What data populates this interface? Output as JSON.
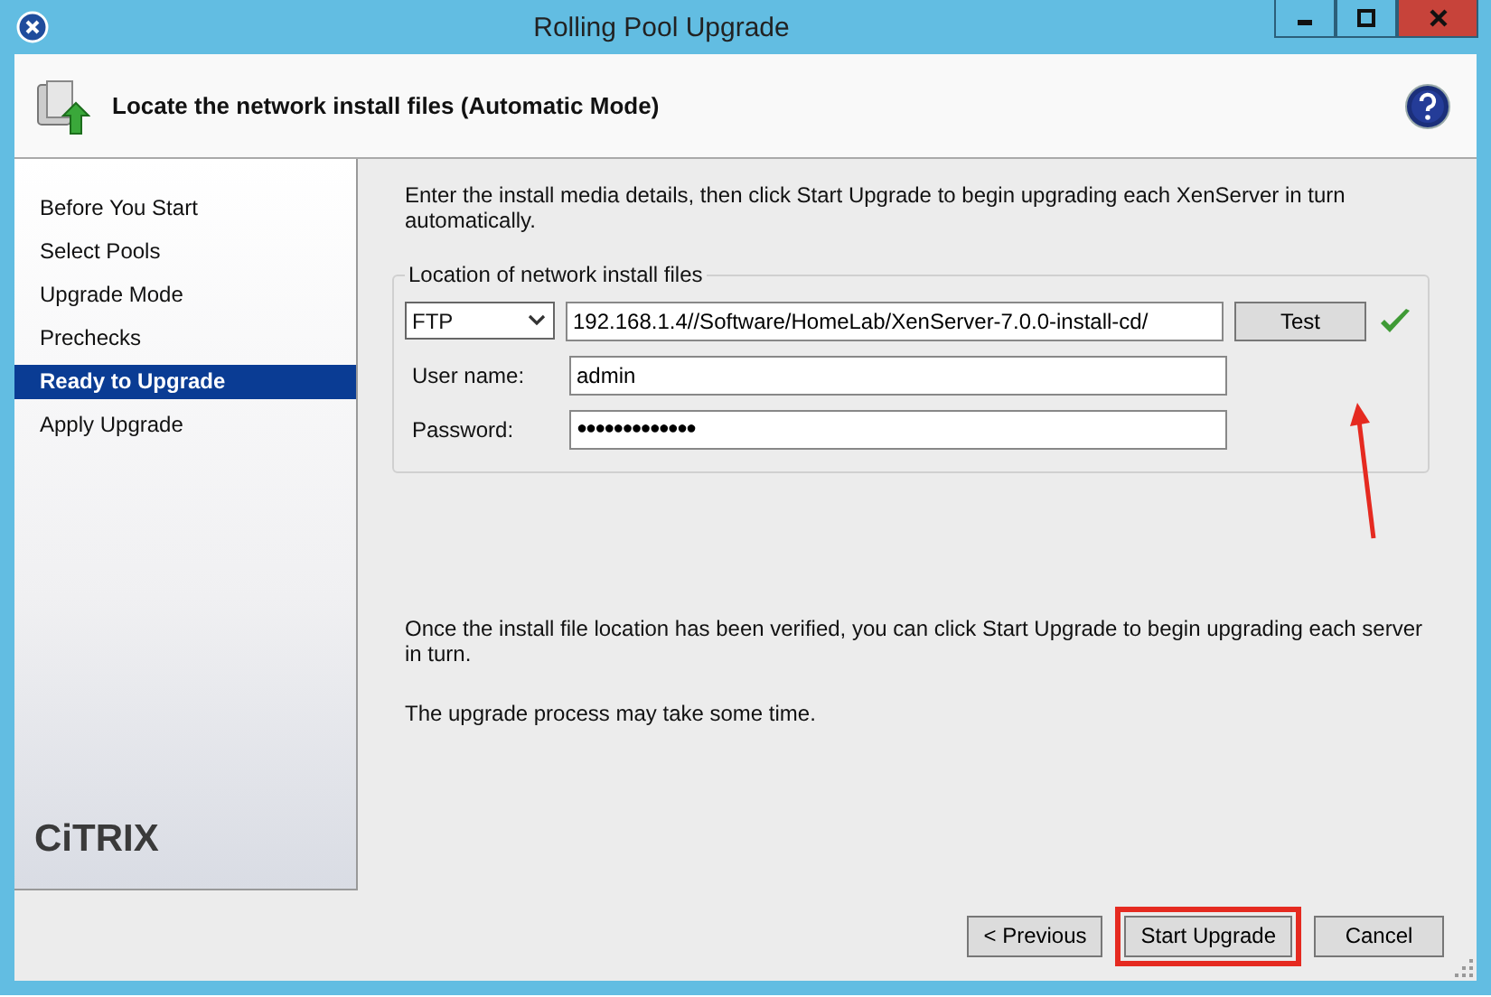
{
  "window": {
    "title": "Rolling Pool Upgrade"
  },
  "header": {
    "title": "Locate the network install files (Automatic Mode)"
  },
  "sidebar": {
    "items": [
      {
        "label": "Before You Start",
        "selected": false
      },
      {
        "label": "Select Pools",
        "selected": false
      },
      {
        "label": "Upgrade Mode",
        "selected": false
      },
      {
        "label": "Prechecks",
        "selected": false
      },
      {
        "label": "Ready to Upgrade",
        "selected": true
      },
      {
        "label": "Apply Upgrade",
        "selected": false
      }
    ],
    "logo": "CiTRIX"
  },
  "main": {
    "intro": "Enter the install media details, then click Start Upgrade to begin upgrading each XenServer in turn automatically.",
    "group": {
      "title": "Location of network install files",
      "protocol": "FTP",
      "url": "192.168.1.4//Software/HomeLab/XenServer-7.0.0-install-cd/",
      "test_button": "Test",
      "verified": true,
      "fields": [
        {
          "label": "User name:",
          "value": "admin",
          "kind": "text"
        },
        {
          "label": "Password:",
          "value": "●●●●●●●●●●●●●",
          "kind": "password"
        }
      ]
    },
    "notes": [
      "Once the install file location has been verified, you can click Start Upgrade to begin upgrading each server in turn.",
      "The upgrade process may take some time."
    ]
  },
  "buttons": [
    {
      "label": "< Previous",
      "highlighted": false
    },
    {
      "label": "Start Upgrade",
      "highlighted": true
    },
    {
      "label": "Cancel",
      "highlighted": false
    }
  ]
}
